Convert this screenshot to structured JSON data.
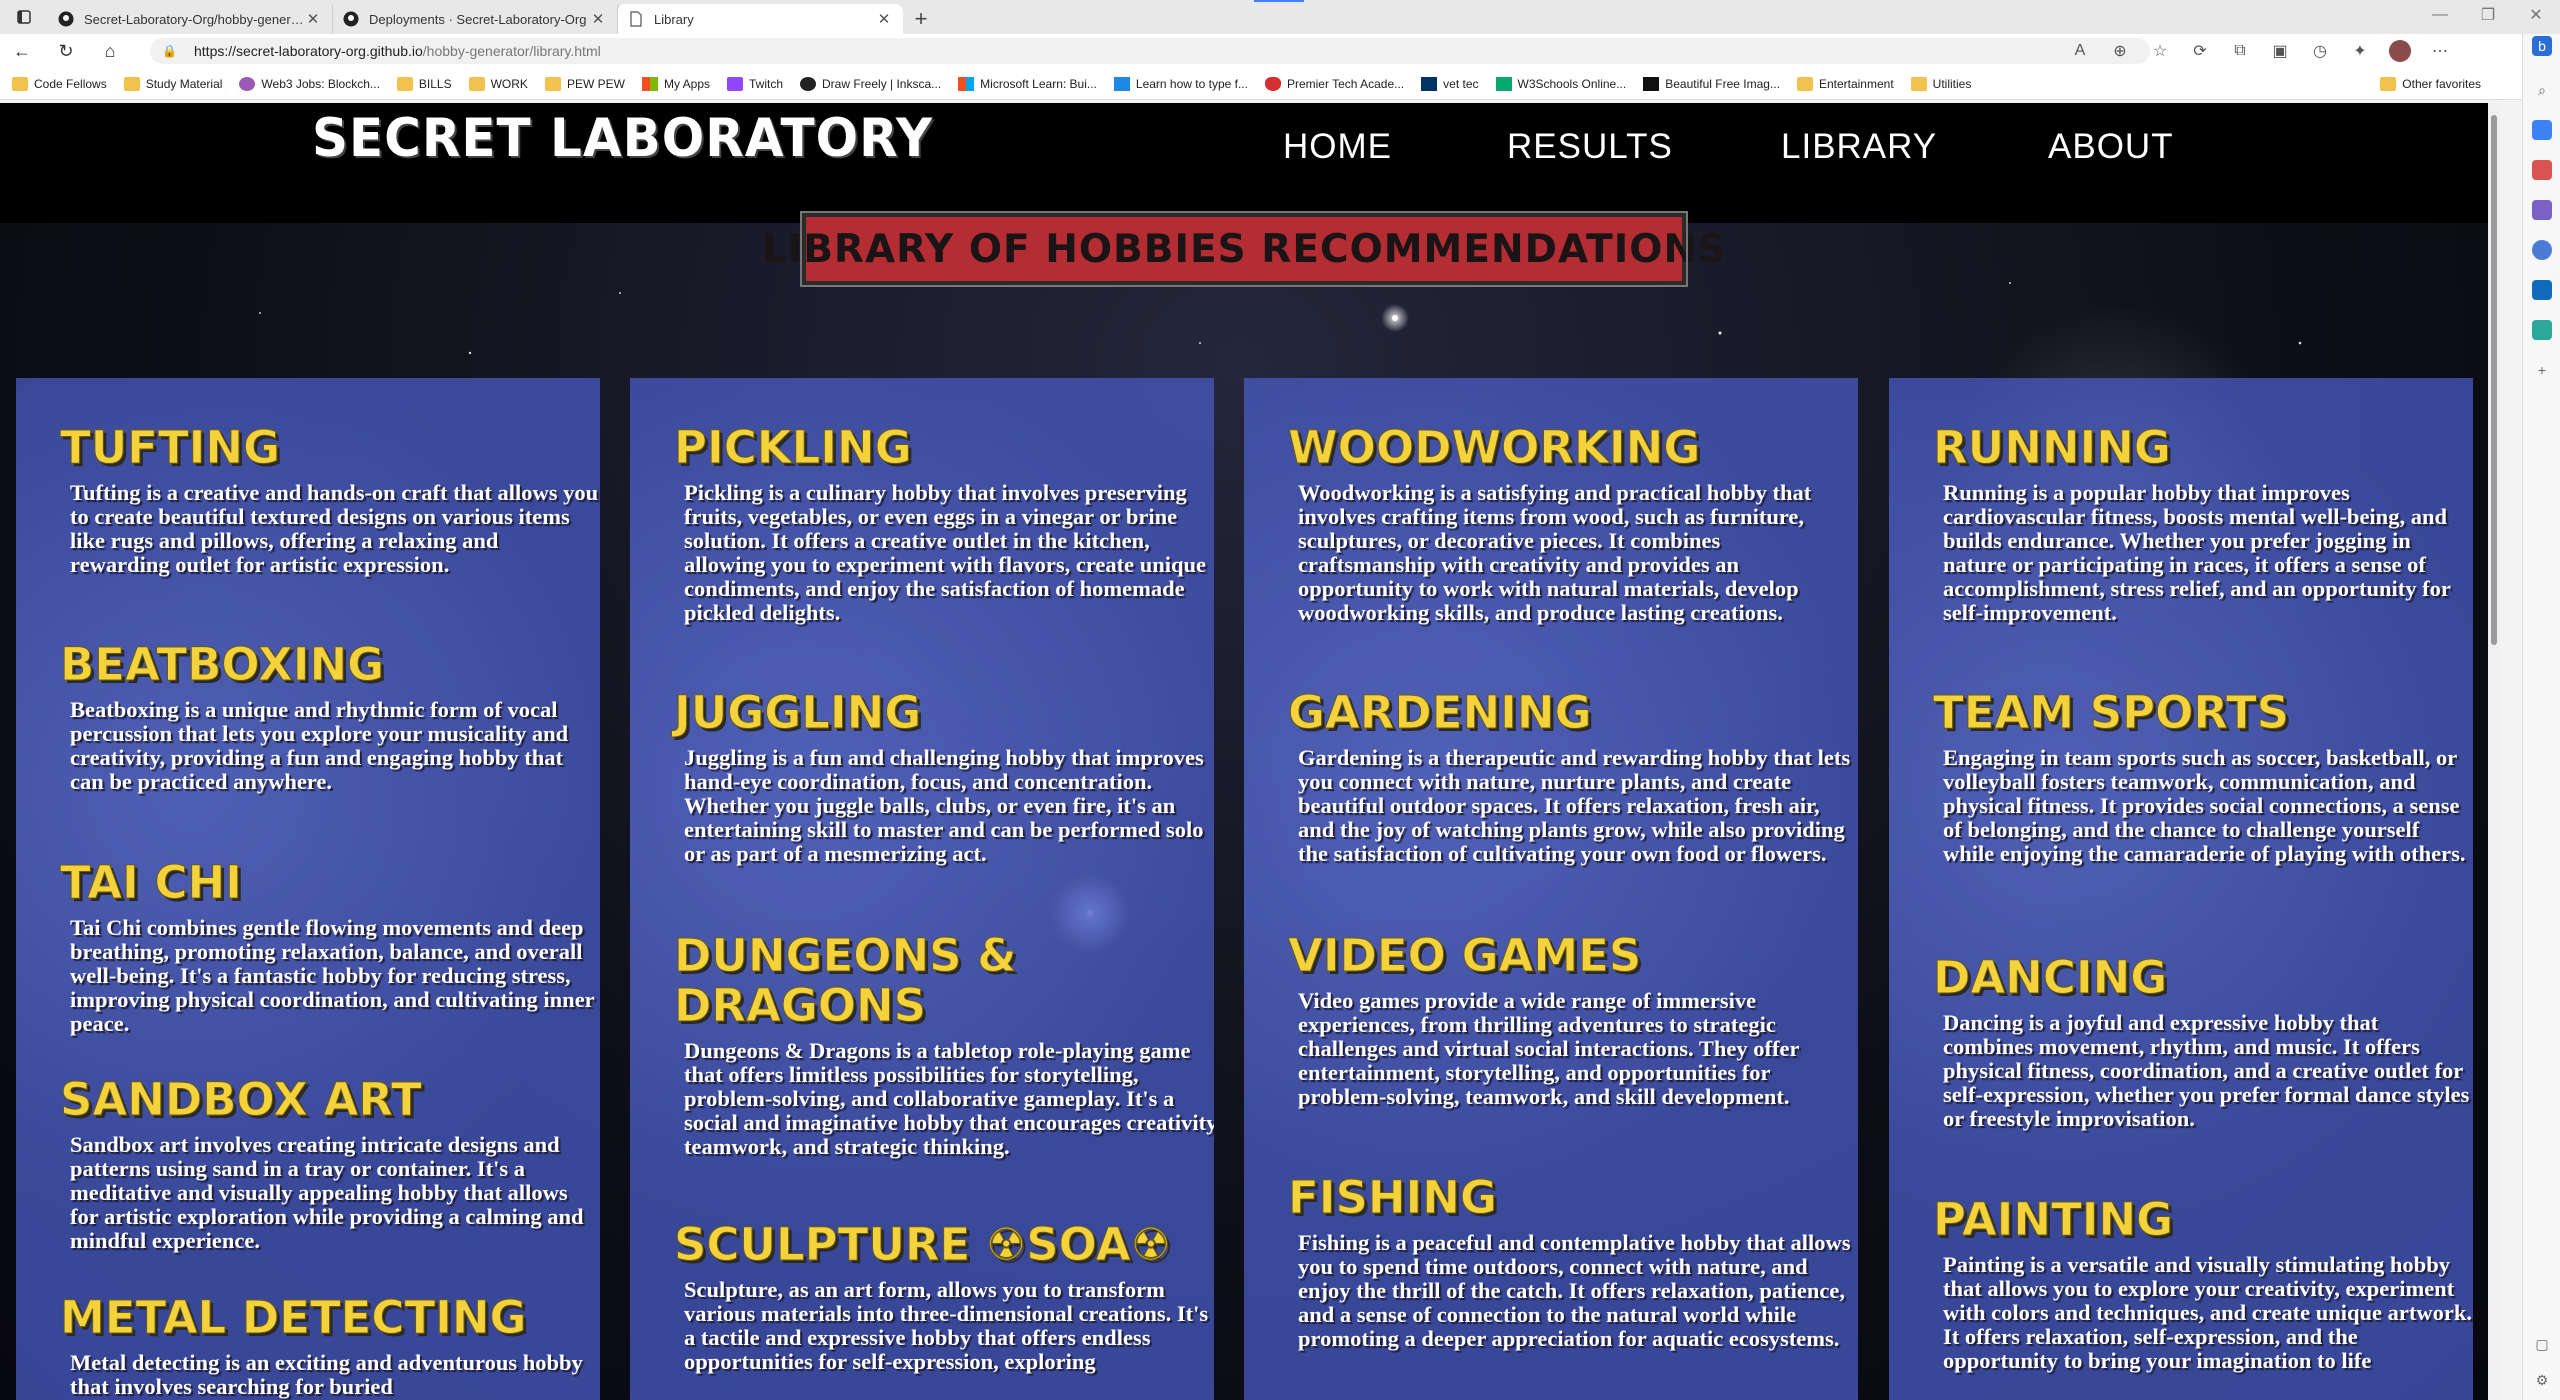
{
  "browser": {
    "tabs": [
      {
        "title": "Secret-Laboratory-Org/hobby-generator",
        "icon": "github-icon"
      },
      {
        "title": "Deployments · Secret-Laboratory-Org",
        "icon": "github-icon"
      },
      {
        "title": "Library",
        "icon": "page-icon"
      }
    ],
    "url_host": "https://secret-laboratory-org.github.io",
    "url_path": "/hobby-generator/library.html",
    "bookmarks": [
      "Code Fellows",
      "Study Material",
      "Web3 Jobs: Blockch...",
      "BILLS",
      "WORK",
      "PEW PEW",
      "My Apps",
      "Twitch",
      "Draw Freely | Inksca...",
      "Microsoft Learn: Bui...",
      "Learn how to type f...",
      "Premier Tech Acade...",
      "vet tec",
      "W3Schools Online...",
      "Beautiful Free Imag...",
      "Entertainment",
      "Utilities"
    ],
    "other_favorites": "Other favorites"
  },
  "site": {
    "logo": "Secret Laboratory",
    "nav": [
      "HOME",
      "RESULTS",
      "LIBRARY",
      "ABOUT"
    ],
    "banner": "Library of Hobbies Recommendations"
  },
  "columns": [
    [
      {
        "title": "Tufting",
        "text": "Tufting is a creative and hands-on craft that allows you to create beautiful textured designs on various items like rugs and pillows, offering a relaxing and rewarding outlet for artistic expression."
      },
      {
        "title": "Beatboxing",
        "text": "Beatboxing is a unique and rhythmic form of vocal percussion that lets you explore your musicality and creativity, providing a fun and engaging hobby that can be practiced anywhere."
      },
      {
        "title": "Tai Chi",
        "text": "Tai Chi combines gentle flowing movements and deep breathing, promoting relaxation, balance, and overall well-being. It's a fantastic hobby for reducing stress, improving physical coordination, and cultivating inner peace."
      },
      {
        "title": "Sandbox Art",
        "text": "Sandbox art involves creating intricate designs and patterns using sand in a tray or container. It's a meditative and visually appealing hobby that allows for artistic exploration while providing a calming and mindful experience."
      },
      {
        "title": "Metal Detecting",
        "text": "Metal detecting is an exciting and adventurous hobby that involves searching for buried"
      }
    ],
    [
      {
        "title": "Pickling",
        "text": "Pickling is a culinary hobby that involves preserving fruits, vegetables, or even eggs in a vinegar or brine solution. It offers a creative outlet in the kitchen, allowing you to experiment with flavors, create unique condiments, and enjoy the satisfaction of homemade pickled delights."
      },
      {
        "title": "Juggling",
        "text": "Juggling is a fun and challenging hobby that improves hand-eye coordination, focus, and concentration. Whether you juggle balls, clubs, or even fire, it's an entertaining skill to master and can be performed solo or as part of a mesmerizing act."
      },
      {
        "title": "Dungeons & Dragons",
        "text": "Dungeons & Dragons is a tabletop role-playing game that offers limitless possibilities for storytelling, problem-solving, and collaborative gameplay. It's a social and imaginative hobby that encourages creativity, teamwork, and strategic thinking."
      },
      {
        "title": "Sculpture ☢SOA☢",
        "text": "Sculpture, as an art form, allows you to transform various materials into three-dimensional creations. It's a tactile and expressive hobby that offers endless opportunities for self-expression, exploring"
      }
    ],
    [
      {
        "title": "Woodworking",
        "text": "Woodworking is a satisfying and practical hobby that involves crafting items from wood, such as furniture, sculptures, or decorative pieces. It combines craftsmanship with creativity and provides an opportunity to work with natural materials, develop woodworking skills, and produce lasting creations."
      },
      {
        "title": "Gardening",
        "text": "Gardening is a therapeutic and rewarding hobby that lets you connect with nature, nurture plants, and create beautiful outdoor spaces. It offers relaxation, fresh air, and the joy of watching plants grow, while also providing the satisfaction of cultivating your own food or flowers."
      },
      {
        "title": "Video Games",
        "text": "Video games provide a wide range of immersive experiences, from thrilling adventures to strategic challenges and virtual social interactions. They offer entertainment, storytelling, and opportunities for problem-solving, teamwork, and skill development."
      },
      {
        "title": "Fishing",
        "text": "Fishing is a peaceful and contemplative hobby that allows you to spend time outdoors, connect with nature, and enjoy the thrill of the catch. It offers relaxation, patience, and a sense of connection to the natural world while promoting a deeper appreciation for aquatic ecosystems."
      }
    ],
    [
      {
        "title": "Running",
        "text": "Running is a popular hobby that improves cardiovascular fitness, boosts mental well-being, and builds endurance. Whether you prefer jogging in nature or participating in races, it offers a sense of accomplishment, stress relief, and an opportunity for self-improvement."
      },
      {
        "title": "Team Sports",
        "text": "Engaging in team sports such as soccer, basketball, or volleyball fosters teamwork, communication, and physical fitness. It provides social connections, a sense of belonging, and the chance to challenge yourself while enjoying the camaraderie of playing with others."
      },
      {
        "title": "Dancing",
        "text": "Dancing is a joyful and expressive hobby that combines movement, rhythm, and music. It offers physical fitness, coordination, and a creative outlet for self-expression, whether you prefer formal dance styles or freestyle improvisation."
      },
      {
        "title": "Painting",
        "text": "Painting is a versatile and visually stimulating hobby that allows you to explore your creativity, experiment with colors and techniques, and create unique artwork. It offers relaxation, self-expression, and the opportunity to bring your imagination to life"
      }
    ]
  ],
  "colors": {
    "title_yellow": "#f4d23c",
    "banner_red": "#b32d32",
    "column_blue": "#4658be"
  }
}
